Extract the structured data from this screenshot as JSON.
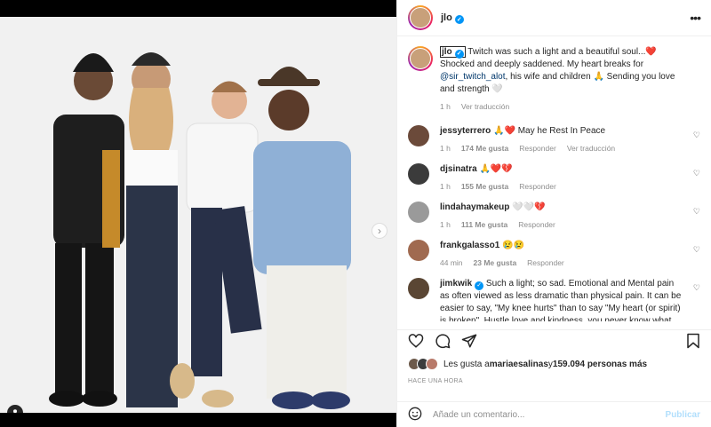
{
  "post": {
    "username": "jlo",
    "more_icon": "more-icon"
  },
  "caption": {
    "username": "jlo",
    "text_a": "Twitch was such a light and a beautiful soul...",
    "emoji_heart": "❤️",
    "text_b": " Shocked and deeply saddened. My heart breaks for ",
    "mention": "@sir_twitch_alot",
    "text_c": ", his wife and children 🙏 Sending you love and strength 🤍",
    "time": "1 h",
    "translate": "Ver traducción"
  },
  "comments": [
    {
      "user": "jessyterrero",
      "text": "🙏❤️ May he Rest In Peace",
      "time": "1 h",
      "likes": "174 Me gusta",
      "reply": "Responder",
      "translate": "Ver traducción",
      "avatar_color": "#6b4a3a"
    },
    {
      "user": "djsinatra",
      "text": "🙏❤️💔",
      "time": "1 h",
      "likes": "155 Me gusta",
      "reply": "Responder",
      "translate": "",
      "avatar_color": "#3b3b3b"
    },
    {
      "user": "lindahaymakeup",
      "text": "🤍🤍💔",
      "time": "1 h",
      "likes": "111 Me gusta",
      "reply": "Responder",
      "translate": "",
      "avatar_color": "#9a9a9a"
    },
    {
      "user": "frankgalasso1",
      "text": "😢😢",
      "time": "44 min",
      "likes": "23 Me gusta",
      "reply": "Responder",
      "translate": "",
      "avatar_color": "#a06a50"
    },
    {
      "user": "jimkwik",
      "text": "Such a light; so sad. Emotional and Mental pain as often viewed as less dramatic than physical pain. It can be easier to say, \"My knee hurts\" than to say \"My heart (or spirit) is broken\". Hustle love and kindness, you never know what",
      "time": "",
      "likes": "",
      "reply": "",
      "translate": "",
      "avatar_color": "#5a4634"
    }
  ],
  "actions": {
    "like_icon": "heart-icon",
    "comment_icon": "comment-icon",
    "share_icon": "share-icon",
    "save_icon": "bookmark-icon"
  },
  "likes": {
    "prefix": "Les gusta a ",
    "user": "mariaesalinas",
    "middle": " y ",
    "count": "159.094 personas más"
  },
  "time_ago": "HACE UNA HORA",
  "comment_box": {
    "placeholder": "Añade un comentario...",
    "publish": "Publicar"
  },
  "colors": {
    "accent": "#0095f6",
    "publish_disabled": "#b2dffc",
    "heart": "#ed4956"
  }
}
